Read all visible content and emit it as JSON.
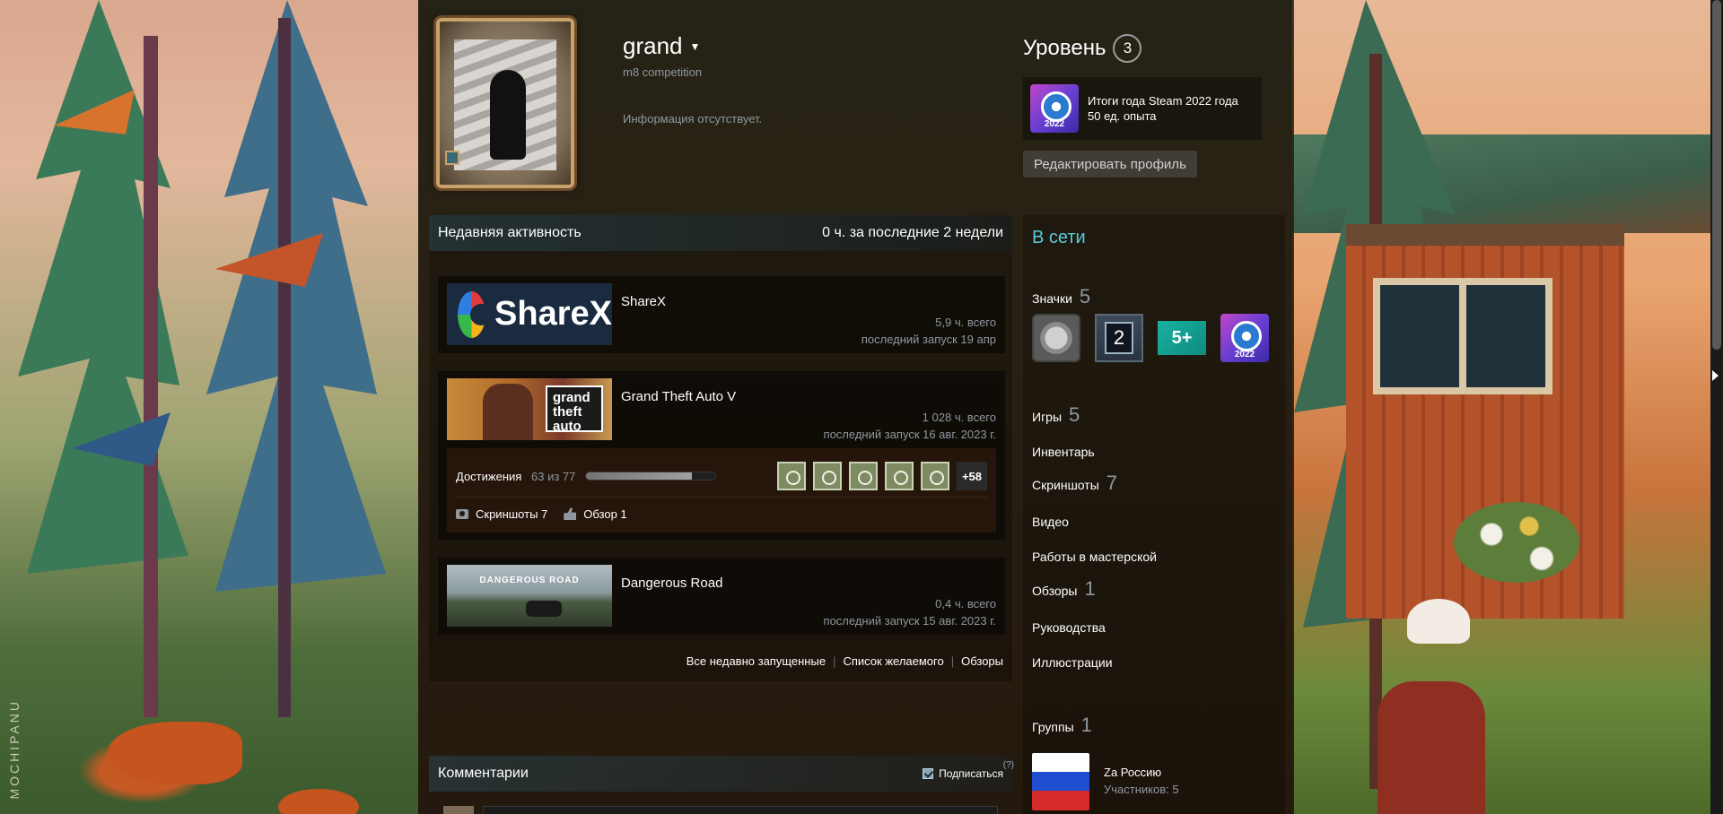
{
  "profile": {
    "persona_name": "grand",
    "real_name": "m8 competition",
    "summary": "Информация отсутствует.",
    "level_label": "Уровень",
    "level": "3",
    "favorite_badge": {
      "title": "Итоги года Steam 2022 года",
      "xp": "50 ед. опыта",
      "year": "2022"
    },
    "edit_button": "Редактировать профиль"
  },
  "activity": {
    "title": "Недавняя активность",
    "hours_prefix": "0 ч. за последние",
    "hours_count": "2",
    "hours_suffix": "недели",
    "games": [
      {
        "name": "ShareX",
        "capsule_text": "ShareX",
        "total": "5,9 ч. всего",
        "last": "последний запуск 19 апр"
      },
      {
        "name": "Grand Theft Auto V",
        "capsule_text": "grand theft auto",
        "total": "1 028 ч. всего",
        "last": "последний запуск 16 авг. 2023 г."
      },
      {
        "name": "Dangerous Road",
        "capsule_text": "DANGEROUS ROAD",
        "total": "0,4 ч. всего",
        "last": "последний запуск 15 авг. 2023 г."
      }
    ],
    "achievements": {
      "label": "Достижения",
      "count": "63 из 77",
      "progress_fraction": 0.818,
      "more": "+58",
      "icons": [
        "achievement-parachute-icon",
        "achievement-globe-icon",
        "achievement-tower-icon",
        "achievement-clapper-icon",
        "achievement-heart-icon"
      ]
    },
    "screenshots_link": "Скриншоты 7",
    "review_link": "Обзор 1",
    "footer": {
      "all_recent": "Все недавно запущенные",
      "wishlist": "Список желаемого",
      "reviews": "Обзоры"
    }
  },
  "comments": {
    "title": "Комментарии",
    "subscribe": "Подписаться",
    "help": "(?)"
  },
  "sidebar": {
    "status": "В сети",
    "badges": {
      "label": "Значки",
      "count": "5",
      "two": "2",
      "five": "5+",
      "year": "2022"
    },
    "games": {
      "label": "Игры",
      "count": "5"
    },
    "inventory": "Инвентарь",
    "screenshots": {
      "label": "Скриншоты",
      "count": "7"
    },
    "videos": "Видео",
    "workshop": "Работы в мастерской",
    "reviews": {
      "label": "Обзоры",
      "count": "1"
    },
    "guides": "Руководства",
    "artwork": "Иллюстрации",
    "groups": {
      "label": "Группы",
      "count": "1"
    },
    "group": {
      "name": "Za Россию",
      "members": "Участников: 5"
    }
  },
  "artwork": {
    "signature": "MOCHIPANU"
  },
  "colors": {
    "online": "#57cbde",
    "text_muted": "#8f98a0",
    "section_head": "#2a4650"
  }
}
